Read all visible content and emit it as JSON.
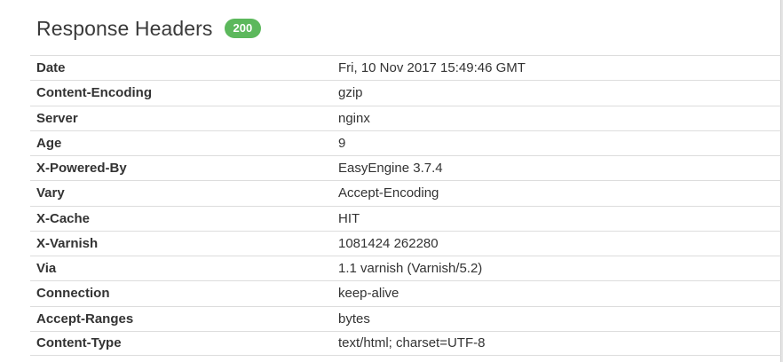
{
  "panel": {
    "title": "Response Headers",
    "status_code": "200"
  },
  "colors": {
    "badge": "#5cb85c",
    "background": "#ffffff",
    "row_border": "#dddddd",
    "text": "#333333"
  },
  "headers": [
    {
      "name": "Date",
      "value": "Fri, 10 Nov 2017 15:49:46 GMT"
    },
    {
      "name": "Content-Encoding",
      "value": "gzip"
    },
    {
      "name": "Server",
      "value": "nginx"
    },
    {
      "name": "Age",
      "value": "9"
    },
    {
      "name": "X-Powered-By",
      "value": "EasyEngine 3.7.4"
    },
    {
      "name": "Vary",
      "value": "Accept-Encoding"
    },
    {
      "name": "X-Cache",
      "value": "HIT"
    },
    {
      "name": "X-Varnish",
      "value": "1081424 262280"
    },
    {
      "name": "Via",
      "value": "1.1 varnish (Varnish/5.2)"
    },
    {
      "name": "Connection",
      "value": "keep-alive"
    },
    {
      "name": "Accept-Ranges",
      "value": "bytes"
    },
    {
      "name": "Content-Type",
      "value": "text/html; charset=UTF-8"
    }
  ]
}
